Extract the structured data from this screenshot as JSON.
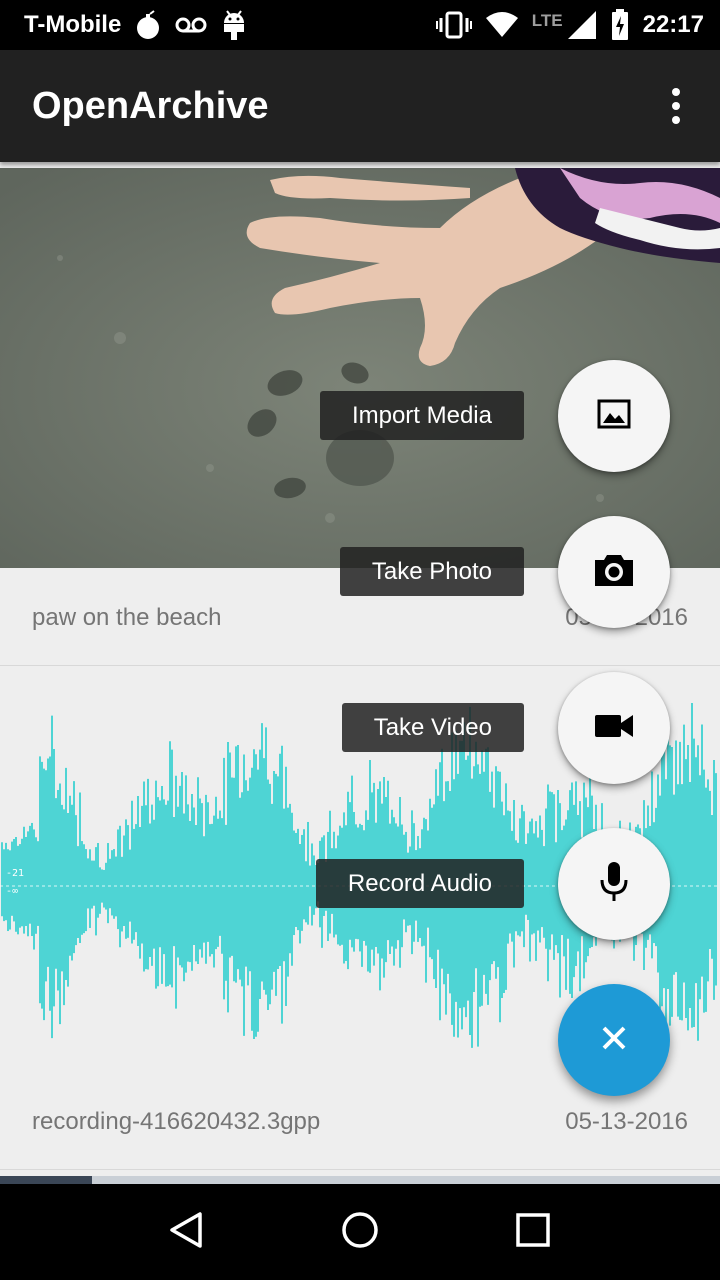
{
  "status_bar": {
    "carrier": "T-Mobile",
    "network": "LTE",
    "time": "22:17",
    "icons": [
      "bomb-icon",
      "voicemail-icon",
      "android-icon",
      "vibrate-icon",
      "wifi-icon",
      "signal-icon",
      "battery-charging-icon"
    ]
  },
  "app_bar": {
    "title": "OpenArchive",
    "menu_icon": "overflow-menu-icon"
  },
  "media_items": [
    {
      "title": "paw on the beach",
      "date": "05-13-2016",
      "type": "photo"
    },
    {
      "title": "recording-416620432.3gpp",
      "date": "05-13-2016",
      "type": "audio",
      "waveform_labels": [
        "-21",
        "-∞"
      ]
    }
  ],
  "fab_menu": {
    "actions": [
      {
        "label": "Import Media",
        "icon": "image-icon"
      },
      {
        "label": "Take Photo",
        "icon": "camera-icon"
      },
      {
        "label": "Take Video",
        "icon": "videocam-icon"
      },
      {
        "label": "Record Audio",
        "icon": "mic-icon"
      }
    ],
    "close_icon": "close-icon"
  },
  "colors": {
    "app_bar": "#212121",
    "fab_main": "#1e9ad6",
    "waveform": "#26cdcd",
    "background": "#eeeeee"
  },
  "nav_bar": {
    "icons": [
      "back-icon",
      "home-icon",
      "recents-icon"
    ]
  }
}
